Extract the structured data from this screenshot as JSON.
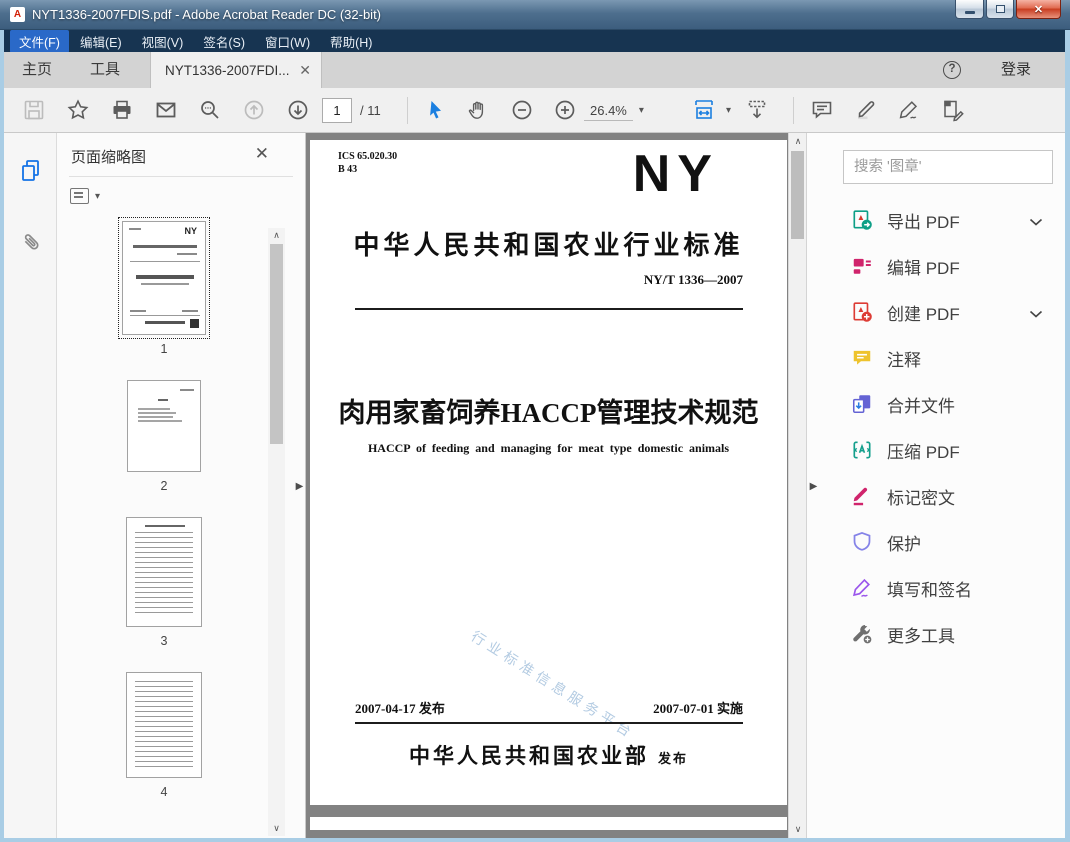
{
  "window": {
    "title": "NYT1336-2007FDIS.pdf - Adobe Acrobat Reader DC (32-bit)"
  },
  "menu": {
    "items": [
      {
        "label": "文件(F)"
      },
      {
        "label": "编辑(E)"
      },
      {
        "label": "视图(V)"
      },
      {
        "label": "签名(S)"
      },
      {
        "label": "窗口(W)"
      },
      {
        "label": "帮助(H)"
      }
    ]
  },
  "tabs": {
    "home": "主页",
    "tools": "工具",
    "document": "NYT1336-2007FDI...",
    "signin": "登录"
  },
  "toolbar": {
    "page_current": "1",
    "page_total": "/ 11",
    "zoom_level": "26.4%"
  },
  "left_panel": {
    "title": "页面缩略图",
    "thumbnails": [
      {
        "num": "1"
      },
      {
        "num": "2"
      },
      {
        "num": "3"
      },
      {
        "num": "4"
      }
    ]
  },
  "document": {
    "ics": "ICS 65.020.30",
    "class_code": "B 43",
    "logo": "NY",
    "standard_title": "中华人民共和国农业行业标准",
    "standard_number": "NY/T 1336—2007",
    "main_title": "肉用家畜饲养HACCP管理技术规范",
    "subtitle_en": "HACCP of feeding and managing for meat type domestic animals",
    "watermark": "行业标准信息服务平台",
    "issue_date": "2007-04-17 发布",
    "impl_date": "2007-07-01 实施",
    "publisher": "中华人民共和国农业部",
    "publisher_suffix": "发布"
  },
  "right_panel": {
    "search_placeholder": "搜索 '图章'",
    "tools": [
      {
        "label": "导出 PDF",
        "icon": "export-pdf-icon",
        "color": "#0e9f87",
        "chevron": true
      },
      {
        "label": "编辑 PDF",
        "icon": "edit-pdf-icon",
        "color": "#d0246c",
        "chevron": false
      },
      {
        "label": "创建 PDF",
        "icon": "create-pdf-icon",
        "color": "#dd3c35",
        "chevron": true
      },
      {
        "label": "注释",
        "icon": "comment-icon",
        "color": "#eec32d",
        "chevron": false
      },
      {
        "label": "合并文件",
        "icon": "combine-files-icon",
        "color": "#6463d4",
        "chevron": false
      },
      {
        "label": "压缩 PDF",
        "icon": "compress-pdf-icon",
        "color": "#149f8c",
        "chevron": false
      },
      {
        "label": "标记密文",
        "icon": "redact-icon",
        "color": "#d0246c",
        "chevron": false
      },
      {
        "label": "保护",
        "icon": "protect-icon",
        "color": "#8583e8",
        "chevron": false
      },
      {
        "label": "填写和签名",
        "icon": "fill-sign-icon",
        "color": "#9a55ec",
        "chevron": false
      },
      {
        "label": "更多工具",
        "icon": "more-tools-icon",
        "color": "#6f6f6f",
        "chevron": false
      }
    ]
  },
  "colors": {
    "accent_blue": "#1473e6",
    "doc_background": "#828282",
    "menu_highlight": "#2a69c8",
    "window_frame": "#a9cde5"
  }
}
